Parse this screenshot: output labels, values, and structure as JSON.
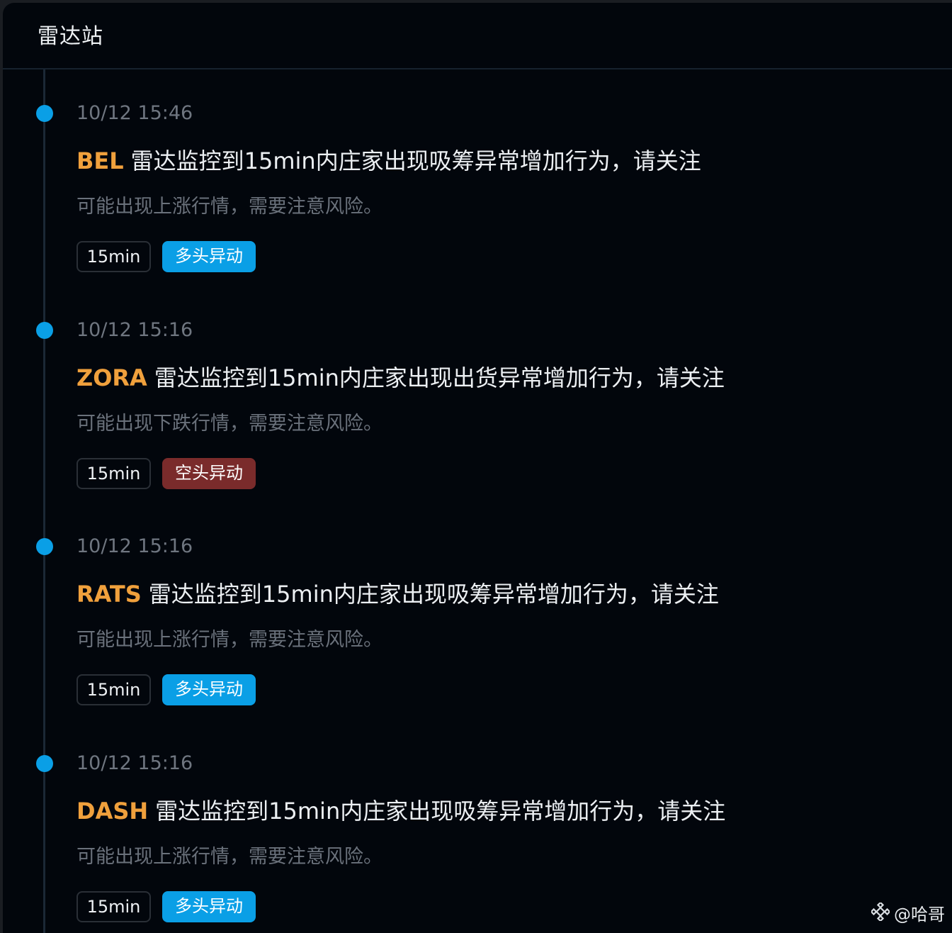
{
  "header": {
    "title": "雷达站"
  },
  "colors": {
    "bullish": "#0a9fe6",
    "bearish": "#7a2b2b",
    "symbol": "#f0a03c",
    "timeline_dot": "#0a9fe6"
  },
  "entries": [
    {
      "time": "10/12 15:46",
      "symbol": "BEL",
      "message": "雷达监控到15min内庄家出现吸筹异常增加行为，请关注",
      "desc": "可能出现上涨行情，需要注意风险。",
      "interval": "15min",
      "signal": "多头异动",
      "signal_type": "bullish"
    },
    {
      "time": "10/12 15:16",
      "symbol": "ZORA",
      "message": "雷达监控到15min内庄家出现出货异常增加行为，请关注",
      "desc": "可能出现下跌行情，需要注意风险。",
      "interval": "15min",
      "signal": "空头异动",
      "signal_type": "bearish"
    },
    {
      "time": "10/12 15:16",
      "symbol": "RATS",
      "message": "雷达监控到15min内庄家出现吸筹异常增加行为，请关注",
      "desc": "可能出现上涨行情，需要注意风险。",
      "interval": "15min",
      "signal": "多头异动",
      "signal_type": "bullish"
    },
    {
      "time": "10/12 15:16",
      "symbol": "DASH",
      "message": "雷达监控到15min内庄家出现吸筹异常增加行为，请关注",
      "desc": "可能出现上涨行情，需要注意风险。",
      "interval": "15min",
      "signal": "多头异动",
      "signal_type": "bullish"
    }
  ],
  "watermark": {
    "icon": "binance-logo-icon",
    "text": "@哈哥"
  }
}
